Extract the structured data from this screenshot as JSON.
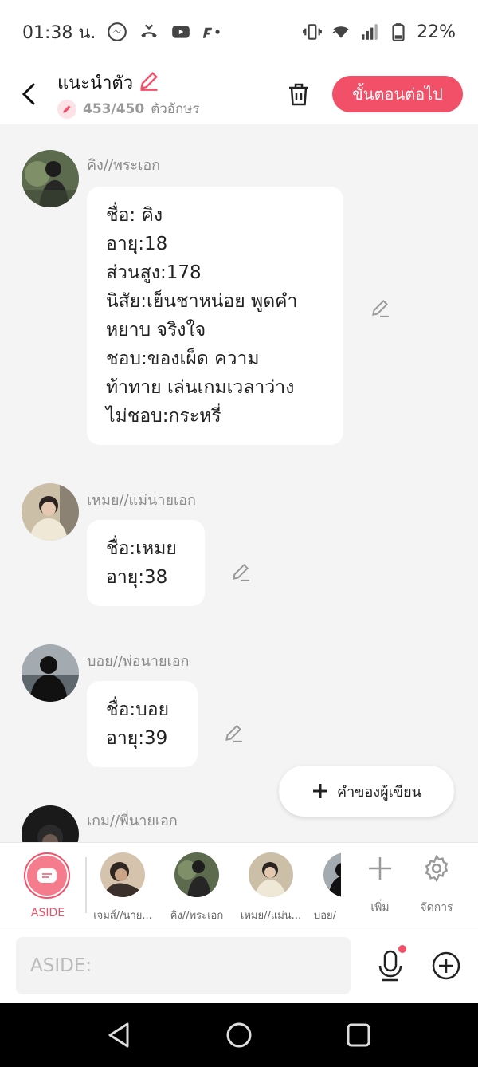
{
  "status_bar": {
    "time": "01:38 น.",
    "battery": "22%",
    "icons": [
      "messenger-icon",
      "missed-call-icon",
      "youtube-icon",
      "app-icon",
      "vibrate-icon",
      "wifi-icon",
      "signal-icon",
      "battery-icon"
    ]
  },
  "header": {
    "title": "แนะนำตัว",
    "char_count": "453/450",
    "char_unit": "ตัวอักษร",
    "next_label": "ขั้นตอนต่อไป",
    "accent_color": "#f25068"
  },
  "messages": [
    {
      "name": "คิง//พระเอก",
      "text": "ชื่อ: คิง\nอายุ:18\nส่วนสูง:178\nนิสัย:เย็นชาหน่อย พูดคำ\nหยาบ จริงใจ\nชอบ:ของเผ็ด ความ\nท้าทาย เล่นเกมเวลาว่าง\nไม่ชอบ:กระหรี่"
    },
    {
      "name": "เหมย//แม่นายเอก",
      "text": "ชื่อ:เหมย\nอายุ:38"
    },
    {
      "name": "บอย//พ่อนายเอก",
      "text": "ชื่อ:บอย\nอายุ:39"
    },
    {
      "name": "เกม//พี่นายเอก",
      "text": ""
    }
  ],
  "author_button": {
    "label": "คำของผู้เขียน"
  },
  "character_bar": {
    "aside_label": "ASIDE",
    "characters": [
      "เจมส์//นาย...",
      "คิง//พระเอก",
      "เหมย//แม่น...",
      "บอย/"
    ],
    "add_label": "เพิ่ม",
    "manage_label": "จัดการ"
  },
  "input": {
    "placeholder": "ASIDE:"
  }
}
